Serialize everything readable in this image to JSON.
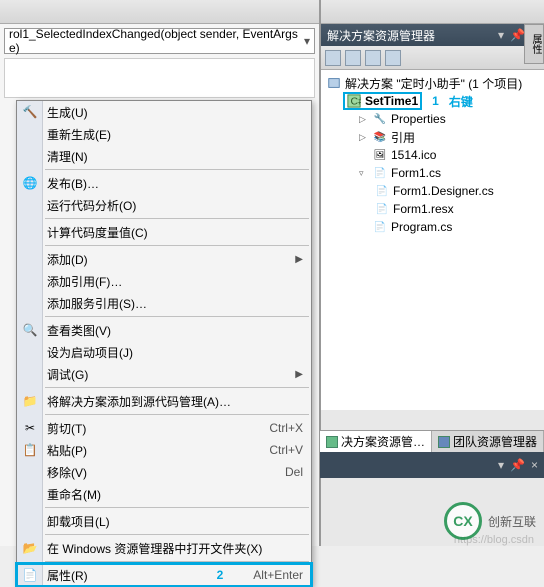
{
  "left": {
    "dropdown": "rol1_SelectedIndexChanged(object sender, EventArgs e)"
  },
  "solution_explorer": {
    "title": "解决方案资源管理器",
    "root": "解决方案 \"定时小助手\" (1 个项目)",
    "project": "SetTime1",
    "annotation1_num": "1",
    "annotation1_text": "右键",
    "nodes": {
      "properties": "Properties",
      "references": "引用",
      "ico": "1514.ico",
      "form1": "Form1.cs",
      "form1_designer": "Form1.Designer.cs",
      "form1_resx": "Form1.resx",
      "program": "Program.cs"
    }
  },
  "tabs": {
    "solution": "决方案资源管…",
    "team": "团队资源管理器"
  },
  "bottom_panel": "",
  "narrow": "属性",
  "context_menu": {
    "build": "生成(U)",
    "rebuild": "重新生成(E)",
    "clean": "清理(N)",
    "publish": "发布(B)…",
    "code_analysis": "运行代码分析(O)",
    "code_metrics": "计算代码度量值(C)",
    "add": "添加(D)",
    "add_reference": "添加引用(F)…",
    "add_service_ref": "添加服务引用(S)…",
    "view_class_diagram": "查看类图(V)",
    "set_startup": "设为启动项目(J)",
    "debug": "调试(G)",
    "add_to_scc": "将解决方案添加到源代码管理(A)…",
    "cut": "剪切(T)",
    "cut_key": "Ctrl+X",
    "paste": "粘贴(P)",
    "paste_key": "Ctrl+V",
    "remove": "移除(V)",
    "remove_key": "Del",
    "rename": "重命名(M)",
    "unload": "卸载项目(L)",
    "open_explorer": "在 Windows 资源管理器中打开文件夹(X)",
    "properties": "属性(R)",
    "properties_key": "Alt+Enter",
    "annotation2": "2"
  },
  "watermark": {
    "logo": "CX",
    "text": "创新互联"
  },
  "blog": "https://blog.csdn"
}
